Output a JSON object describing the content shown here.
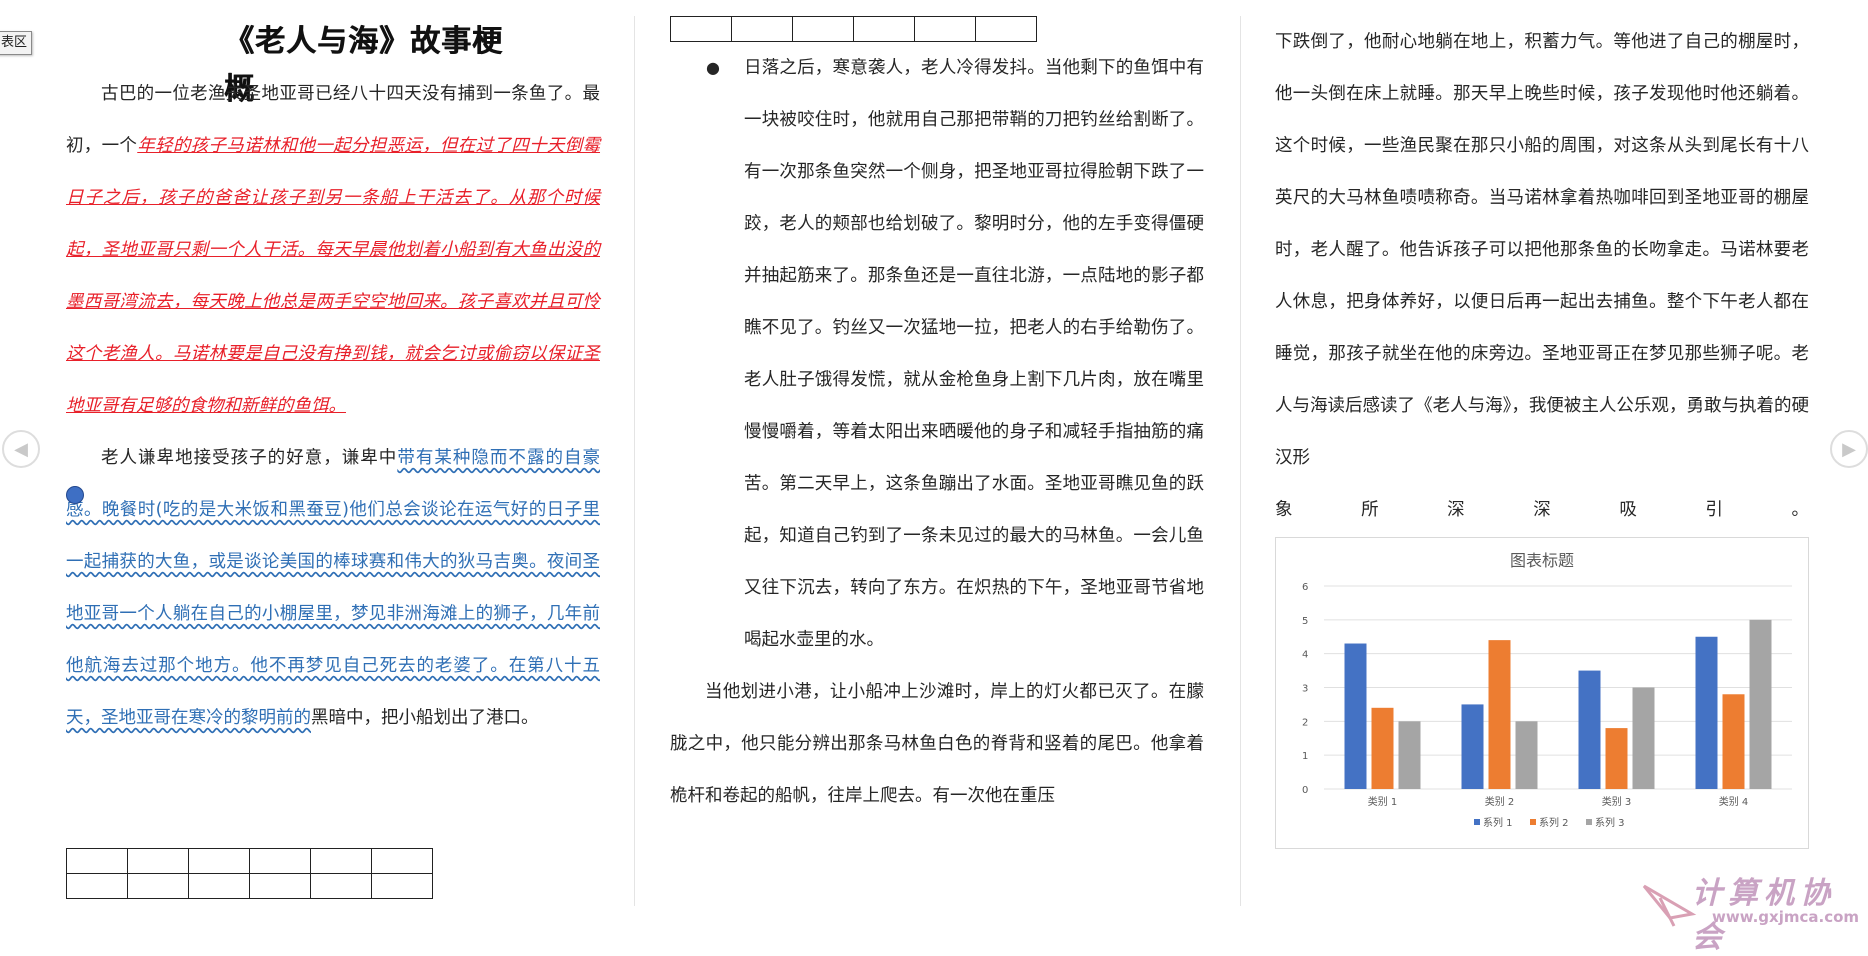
{
  "side_tab": "表区",
  "title": "《老人与海》故事梗概",
  "col1": {
    "p1_a": "古巴的一位老渔夫圣地亚哥已经八十四天没有捕到一条鱼了。最初，一个",
    "p1_red": "年轻的孩子马诺林和他一起分担恶运，但在过了四十天倒霉日子之后，孩子的爸爸让孩子到另一条船上干活去了。从那个时候起，圣地亚哥只剩一个人干活。每天早晨他划着小船到有大鱼出没的墨西哥湾流去，每天晚上他总是两手空空地回来。孩子喜欢并且可怜这个老渔人。马诺林要是自己没有挣到钱，就会乞讨或偷窃以保证圣地亚哥有足够的食物和新鲜的鱼饵。",
    "p2_a": "老人谦卑地接受孩子的好意，谦卑中",
    "p2_blue": "带有某种隐而不露的自豪感。晚餐时(吃的是大米饭和黑蚕豆)他们总会谈论在运气好的日子里一起捕获的大鱼，或是谈论美国的棒球赛和伟大的狄马吉奥。夜间圣地亚哥一个人躺在自己的小棚屋里，梦见非洲海滩上的狮子，几年前他航海去过那个地方。他不再梦见自己死去的老婆了。在第八十五天，圣地亚哥在寒冷的黎明前的",
    "p2_b": "黑暗中，把小船划出了港口。"
  },
  "col2": {
    "bullet_text": "日落之后，寒意袭人，老人冷得发抖。当他剩下的鱼饵中有一块被咬住时，他就用自己那把带鞘的刀把钓丝给割断了。有一次那条鱼突然一个侧身，把圣地亚哥拉得脸朝下跌了一跤，老人的颊部也给划破了。黎明时分，他的左手变得僵硬并抽起筋来了。那条鱼还是一直往北游，一点陆地的影子都瞧不见了。钓丝又一次猛地一拉，把老人的右手给勒伤了。老人肚子饿得发慌，就从金枪鱼身上割下几片肉，放在嘴里慢慢嚼着，等着太阳出来晒暖他的身子和减轻手指抽筋的痛苦。第二天早上，这条鱼蹦出了水面。圣地亚哥瞧见鱼的跃起，知道自己钓到了一条未见过的最大的马林鱼。一会儿鱼又往下沉去，转向了东方。在炽热的下午，圣地亚哥节省地喝起水壶里的水。",
    "p_after": "当他划进小港，让小船冲上沙滩时，岸上的灯火都已灭了。在朦胧之中，他只能分辨出那条马林鱼白色的脊背和竖着的尾巴。他拿着桅杆和卷起的船帆，往岸上爬去。有一次他在重压"
  },
  "col3": {
    "p_text": "下跌倒了，他耐心地躺在地上，积蓄力气。等他进了自己的棚屋时，他一头倒在床上就睡。那天早上晚些时候，孩子发现他时他还躺着。这个时候，一些渔民聚在那只小船的周围，对这条从头到尾长有十八英尺的大马林鱼啧啧称奇。当马诺林拿着热咖啡回到圣地亚哥的棚屋时，老人醒了。他告诉孩子可以把他那条鱼的长吻拿走。马诺林要老人休息，把身体养好，以便日后再一起出去捕鱼。整个下午老人都在睡觉，那孩子就坐在他的床旁边。圣地亚哥正在梦见那些狮子呢。老人与海读后感读了《老人与海》，我便被主人公乐观，勇敢与执着的硬汉形",
    "p_last": "象所深深吸引。"
  },
  "chart_data": {
    "type": "bar",
    "title": "图表标题",
    "categories": [
      "类别 1",
      "类别 2",
      "类别 3",
      "类别 4"
    ],
    "series": [
      {
        "name": "系列 1",
        "values": [
          4.3,
          2.5,
          3.5,
          4.5
        ],
        "color": "#4472c4"
      },
      {
        "name": "系列 2",
        "values": [
          2.4,
          4.4,
          1.8,
          2.8
        ],
        "color": "#ed7d31"
      },
      {
        "name": "系列 3",
        "values": [
          2,
          2,
          3,
          5
        ],
        "color": "#a5a5a5"
      }
    ],
    "yticks": [
      "0",
      "1",
      "2",
      "3",
      "4",
      "5",
      "6"
    ],
    "ylim": [
      0,
      6
    ],
    "grid": true,
    "legend": "bottom"
  },
  "watermark": {
    "text": "计算机协会",
    "url": "www.gxjmca.com"
  }
}
